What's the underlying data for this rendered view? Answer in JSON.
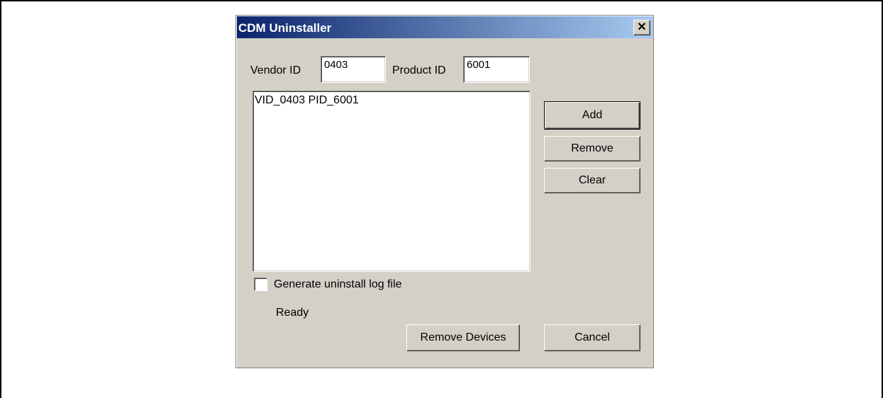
{
  "dialog": {
    "title": "CDM Uninstaller",
    "close_label": "✕",
    "vendor_label": "Vendor ID",
    "vendor_value": "0403",
    "product_label": "Product ID",
    "product_value": "6001",
    "list_items": [
      "VID_0403 PID_6001"
    ],
    "buttons": {
      "add": "Add",
      "remove": "Remove",
      "clear": "Clear",
      "remove_devices": "Remove Devices",
      "cancel": "Cancel"
    },
    "checkbox_label": "Generate uninstall log file",
    "checkbox_checked": false,
    "status": "Ready"
  }
}
